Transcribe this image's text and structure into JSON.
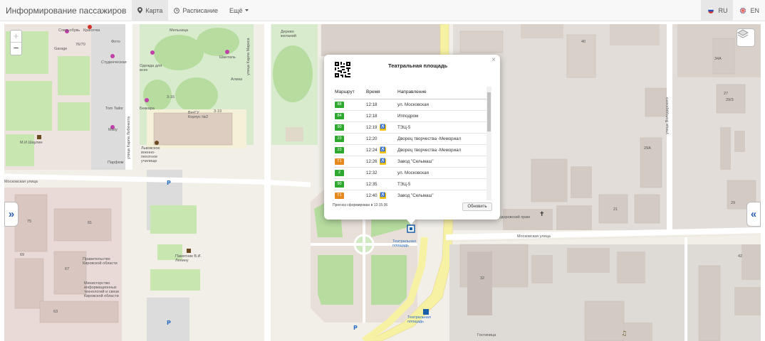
{
  "navbar": {
    "brand": "Информирование пассажиров",
    "tabs": [
      {
        "label": "Карта",
        "icon": "map-marker-icon",
        "active": true
      },
      {
        "label": "Расписание",
        "icon": "clock-icon",
        "active": false
      },
      {
        "label": "Ещё",
        "icon": "caret-down-icon",
        "active": false
      }
    ],
    "languages": [
      {
        "label": "RU",
        "icon": "russia-flag-icon",
        "active": true
      },
      {
        "label": "EN",
        "icon": "uk-flag-icon",
        "active": false
      }
    ]
  },
  "map": {
    "zoom_in": "+",
    "zoom_out": "−",
    "labels": {
      "street_moskovskaya_left": "Московская улица",
      "street_moskovskaya_right": "Московская улица",
      "street_karla_marksa": "улица Карла Маркса",
      "street_karla_libknekhta": "улица Карла Либкнехта",
      "street_volodarskogo": "улица Володарского",
      "derevo": "Дерево желаний",
      "stop_teatralnaya_1": "Театральная площадь",
      "stop_teatralnaya_2": "Театральная площадь",
      "vyatgu": "ВятГУ Корпус №2",
      "monument": "Памятник В.И. Ленину",
      "pravitelstvo": "Правительство Кировской области",
      "ministerstvo": "Министерство информационных технологий и связи Кировской области",
      "hotel": "Гостиница",
      "church": "Фёдоровский храм",
      "almaz": "Алмаз",
      "shantal": "Шанталь",
      "odezhda": "Одежда для всех",
      "melnitsa": "Мельница",
      "studencheskaya": "Студенческая",
      "kaliya": "Фото",
      "bekkara": "Беккара",
      "lvovskoe": "Львовское военно-пехотное училище",
      "parfum": "Парфюм",
      "garage": "Garage",
      "soyuz": "Союз-обувь",
      "krasotka": "Красотка",
      "mir_sheya": "М.И.Шаулин",
      "tom_tailor": "Tom Tailor",
      "misty": "Misty",
      "numbers": [
        "76/70",
        "75",
        "81",
        "67",
        "69",
        "63",
        "40",
        "34А",
        "27",
        "29/3",
        "29А",
        "29",
        "21",
        "42",
        "32",
        "3-16",
        "3-19"
      ]
    }
  },
  "popup": {
    "title": "Театральная площадь",
    "close_label": "×",
    "columns": [
      "Маршрут",
      "Время",
      "Направление"
    ],
    "rows": [
      {
        "route": "88",
        "color": "#2ea82e",
        "time": "12:18",
        "accessible": false,
        "direction": "ул. Московская"
      },
      {
        "route": "84",
        "color": "#2ea82e",
        "time": "12:18",
        "accessible": false,
        "direction": "Ипподром"
      },
      {
        "route": "90",
        "color": "#2ea82e",
        "time": "12:19",
        "accessible": true,
        "direction": "ТЭЦ-5"
      },
      {
        "route": "23",
        "color": "#2ea82e",
        "time": "12:20",
        "accessible": false,
        "direction": "Дворец творчества -Мемориал"
      },
      {
        "route": "23",
        "color": "#2ea82e",
        "time": "12:24",
        "accessible": true,
        "direction": "Дворец творчества -Мемориал"
      },
      {
        "route": "T1",
        "color": "#e68a1f",
        "time": "12:26",
        "accessible": true,
        "direction": "Завод \"Сельмаш\""
      },
      {
        "route": "2",
        "color": "#2ea82e",
        "time": "12:32",
        "accessible": false,
        "direction": "ул. Московская"
      },
      {
        "route": "90",
        "color": "#2ea82e",
        "time": "12:35",
        "accessible": false,
        "direction": "ТЭЦ-5"
      },
      {
        "route": "T1",
        "color": "#e68a1f",
        "time": "12:40",
        "accessible": true,
        "direction": "Завод \"Сельмаш\""
      }
    ],
    "forecast_text": "Прогноз сформирован в 12:15:36",
    "refresh_label": "Обновить"
  }
}
